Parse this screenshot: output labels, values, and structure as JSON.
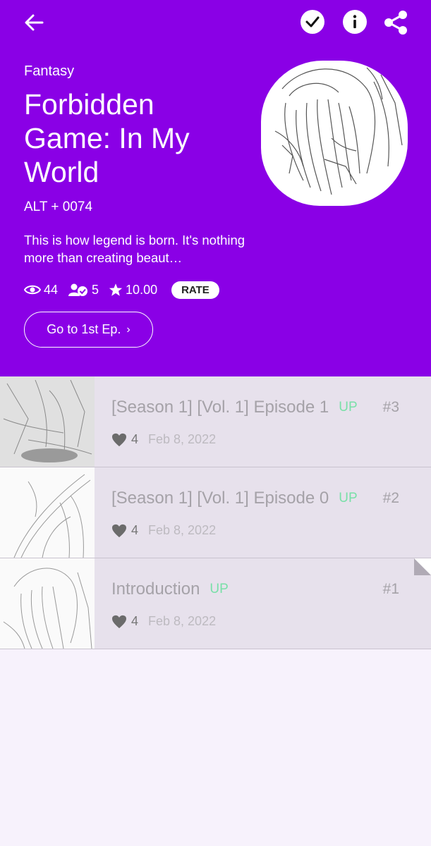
{
  "header": {
    "genre": "Fantasy",
    "title": "Forbidden Game: In My World",
    "author": "ALT + 0074",
    "description": "This is how legend is born. It's nothing more than creating beaut…",
    "views": "44",
    "subscribers": "5",
    "rating": "10.00",
    "rate_label": "RATE",
    "first_episode_label": "Go to 1st Ep."
  },
  "episodes": [
    {
      "title": "[Season 1] [Vol. 1] Episode 1",
      "badge": "UP",
      "number": "#3",
      "likes": "4",
      "date": "Feb 8, 2022"
    },
    {
      "title": "[Season 1] [Vol. 1] Episode 0",
      "badge": "UP",
      "number": "#2",
      "likes": "4",
      "date": "Feb 8, 2022"
    },
    {
      "title": "Introduction",
      "badge": "UP",
      "number": "#1",
      "likes": "4",
      "date": "Feb 8, 2022"
    }
  ],
  "colors": {
    "brand": "#8a00e6",
    "up_badge": "#79e0a8",
    "episode_bg": "#e7e1ec",
    "page_bg": "#f7f2fc"
  },
  "icons": [
    "back-arrow-icon",
    "checkmark-icon",
    "info-icon",
    "share-icon",
    "eye-icon",
    "subscriber-icon",
    "star-icon",
    "chevron-right-icon",
    "heart-icon"
  ]
}
